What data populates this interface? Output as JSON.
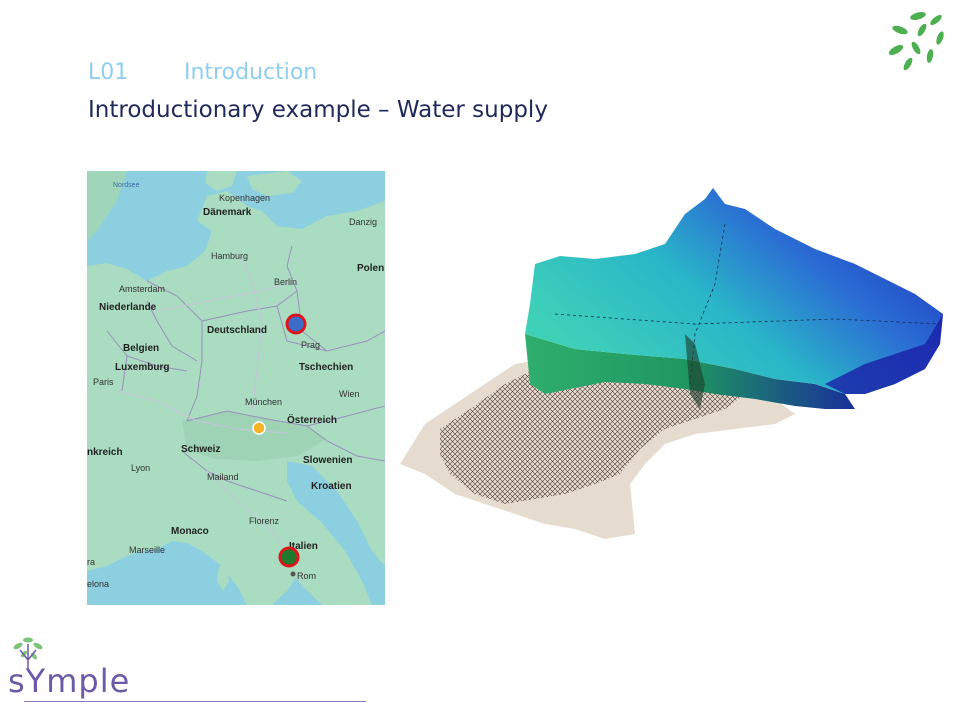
{
  "header": {
    "lecture_code": "L01",
    "lecture_title": "Introduction",
    "slide_title": "Introductionary example – Water supply"
  },
  "map": {
    "labels": {
      "nordsee": "Nordsee",
      "kopenhagen": "Kopenhagen",
      "danemark": "Dänemark",
      "danzig": "Danzig",
      "hamburg": "Hamburg",
      "polen": "Polen",
      "berlin": "Berlin",
      "amsterdam": "Amsterdam",
      "niederlande": "Niederlande",
      "deutschland": "Deutschland",
      "belgien": "Belgien",
      "prag": "Prag",
      "luxemburg": "Luxemburg",
      "tschechien": "Tschechien",
      "wien": "Wien",
      "paris": "Paris",
      "munchen": "München",
      "osterreich": "Österreich",
      "schweiz": "Schweiz",
      "frankreich": "nkreich",
      "lyon": "Lyon",
      "slowenien": "Slowenien",
      "mailand": "Mailand",
      "kroatien": "Kroatien",
      "monaco": "Monaco",
      "florenz": "Florenz",
      "marseille": "Marseille",
      "italien": "Italien",
      "ra": "ra",
      "rom": "Rom",
      "celona": "elona"
    },
    "markers": [
      {
        "name": "berlin-marker",
        "fill": "#3a6cc8",
        "ring": "#e0151b"
      },
      {
        "name": "rome-marker",
        "fill": "#1f7a2e",
        "ring": "#e0151b"
      },
      {
        "name": "alps-star",
        "fill": "#f4b324",
        "ring": "#ffffff"
      }
    ]
  },
  "logo": {
    "text": "sYmple"
  },
  "colors": {
    "accent_light_blue": "#8ecff0",
    "title_navy": "#1f2a5a",
    "logo_purple": "#6a5aa8",
    "leaf_green": "#4caf50"
  }
}
